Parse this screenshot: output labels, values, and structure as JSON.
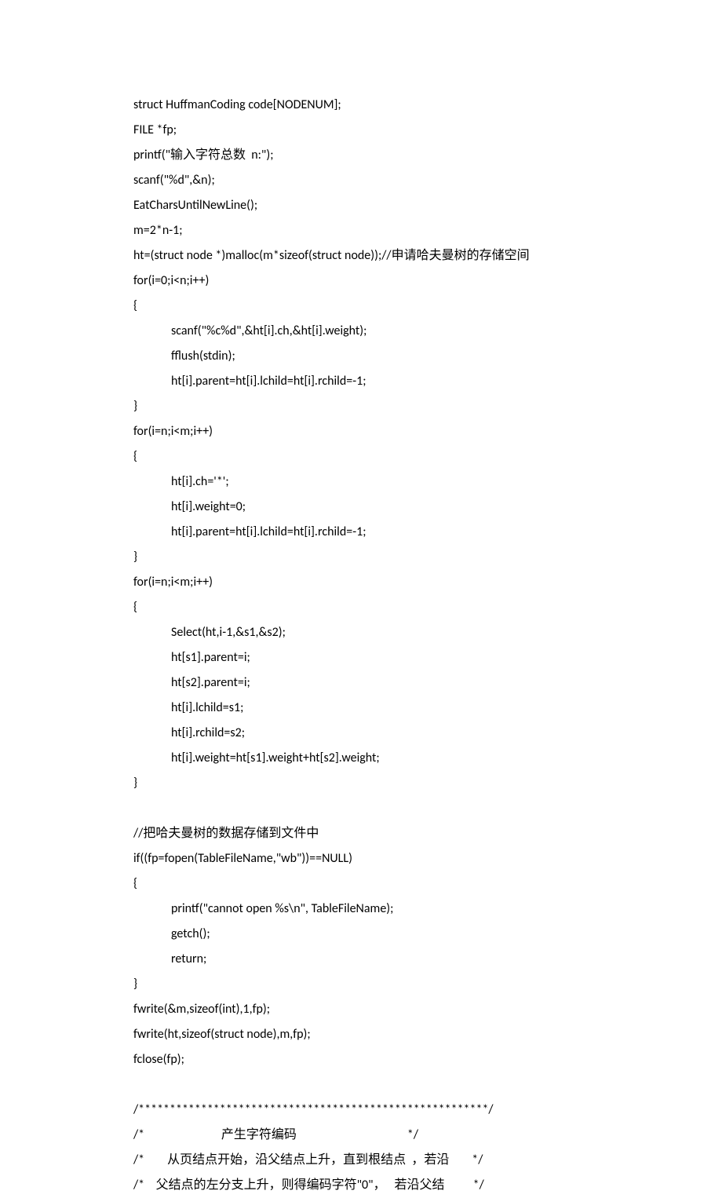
{
  "lines": [
    {
      "c": "l",
      "t": "struct HuffmanCoding code[NODENUM];"
    },
    {
      "c": "l",
      "t": "FILE *fp;"
    },
    {
      "c": "l",
      "t": "printf(\"输入字符总数  n:\");"
    },
    {
      "c": "l",
      "t": "scanf(\"%d\",&n);"
    },
    {
      "c": "l",
      "t": "EatCharsUntilNewLine();"
    },
    {
      "c": "l",
      "t": "m=2*n-1;"
    },
    {
      "c": "l",
      "t": "ht=(struct node *)malloc(m*sizeof(struct node));//申请哈夫曼树的存储空间"
    },
    {
      "c": "l",
      "t": "for(i=0;i<n;i++)"
    },
    {
      "c": "l",
      "t": "{"
    },
    {
      "c": "l i",
      "t": "scanf(\"%c%d\",&ht[i].ch,&ht[i].weight);"
    },
    {
      "c": "l i",
      "t": "fflush(stdin);"
    },
    {
      "c": "l i",
      "t": "ht[i].parent=ht[i].lchild=ht[i].rchild=-1;"
    },
    {
      "c": "l",
      "t": "}"
    },
    {
      "c": "l",
      "t": "for(i=n;i<m;i++)"
    },
    {
      "c": "l",
      "t": "{"
    },
    {
      "c": "l i",
      "t": "ht[i].ch='*';"
    },
    {
      "c": "l i",
      "t": "ht[i].weight=0;"
    },
    {
      "c": "l i",
      "t": "ht[i].parent=ht[i].lchild=ht[i].rchild=-1;"
    },
    {
      "c": "l",
      "t": "}"
    },
    {
      "c": "l",
      "t": "for(i=n;i<m;i++)"
    },
    {
      "c": "l",
      "t": "{"
    },
    {
      "c": "l i",
      "t": "Select(ht,i-1,&s1,&s2);"
    },
    {
      "c": "l i",
      "t": "ht[s1].parent=i;"
    },
    {
      "c": "l i",
      "t": "ht[s2].parent=i;"
    },
    {
      "c": "l i",
      "t": "ht[i].lchild=s1;"
    },
    {
      "c": "l i",
      "t": "ht[i].rchild=s2;"
    },
    {
      "c": "l i",
      "t": "ht[i].weight=ht[s1].weight+ht[s2].weight;"
    },
    {
      "c": "l",
      "t": "}"
    },
    {
      "c": "l",
      "t": " "
    },
    {
      "c": "l",
      "t": "//把哈夫曼树的数据存储到文件中"
    },
    {
      "c": "l",
      "t": "if((fp=fopen(TableFileName,\"wb\"))==NULL)"
    },
    {
      "c": "l",
      "t": "{"
    },
    {
      "c": "l i",
      "t": "printf(\"cannot open %s\\n\", TableFileName);"
    },
    {
      "c": "l i",
      "t": "getch();"
    },
    {
      "c": "l i",
      "t": "return;"
    },
    {
      "c": "l",
      "t": "}"
    },
    {
      "c": "l",
      "t": "fwrite(&m,sizeof(int),1,fp);"
    },
    {
      "c": "l",
      "t": "fwrite(ht,sizeof(struct node),m,fp);"
    },
    {
      "c": "l",
      "t": "fclose(fp);"
    },
    {
      "c": "l",
      "t": " "
    },
    {
      "c": "l",
      "t": "/********************************************************/"
    },
    {
      "c": "l",
      "t": "/*                           产生字符编码                                       */"
    },
    {
      "c": "l",
      "t": "/*        从页结点开始，沿父结点上升，直到根结点  ，若沿        */"
    },
    {
      "c": "l",
      "t": "/*    父结点的左分支上升，则得编码字符\"0\"，   若沿父结          */"
    }
  ]
}
